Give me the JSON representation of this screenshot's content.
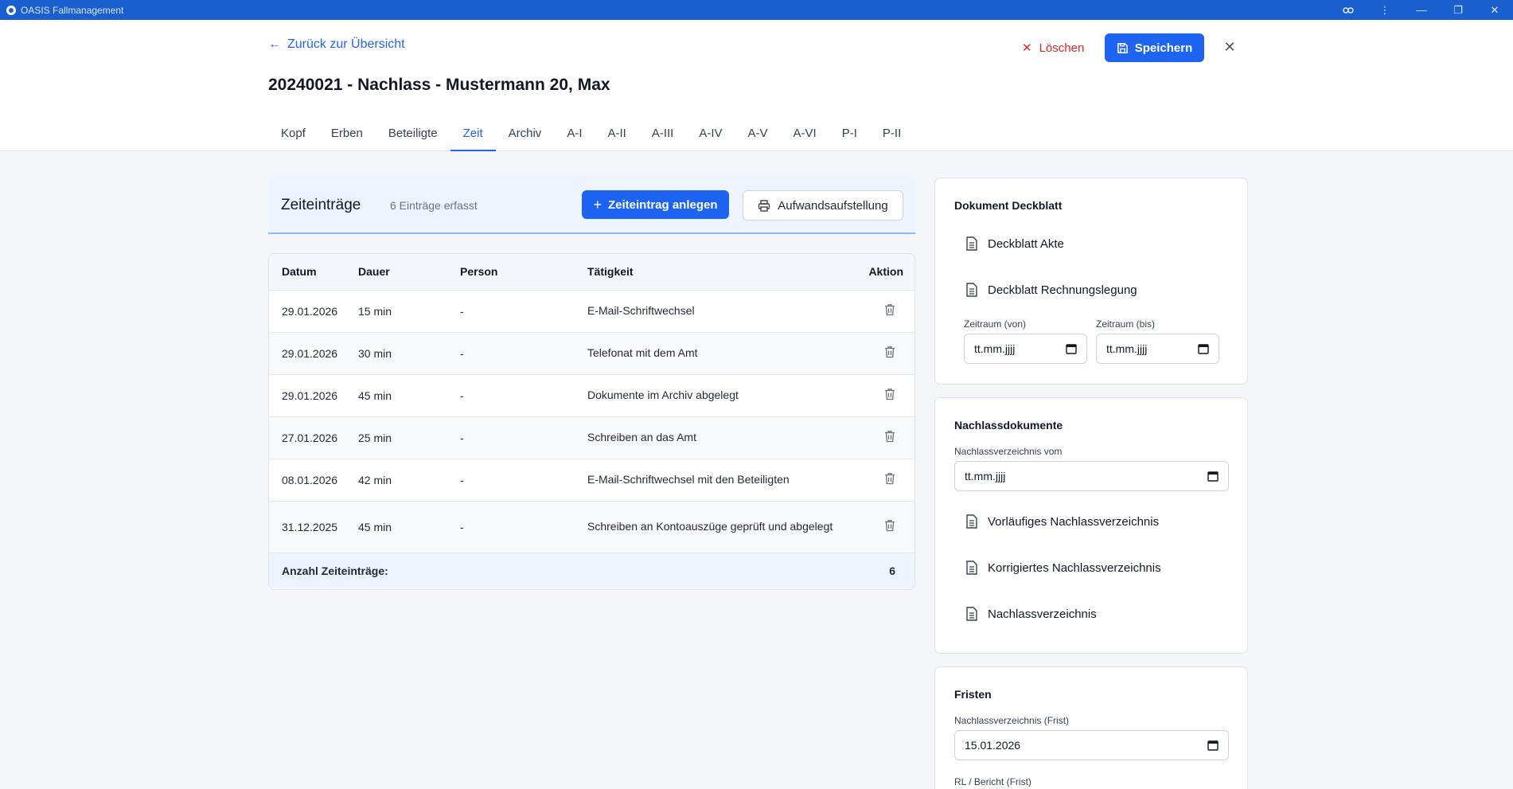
{
  "window": {
    "title": "OASIS Fallmanagement",
    "controls": [
      "key-icon",
      "more-icon",
      "minimize-icon",
      "restore-icon",
      "close-icon"
    ]
  },
  "header": {
    "back_label": "Zurück zur Übersicht",
    "page_title": "20240021 - Nachlass - Mustermann 20, Max",
    "delete_label": "Löschen",
    "save_label": "Speichern",
    "tabs": [
      {
        "label": "Kopf",
        "active": false
      },
      {
        "label": "Erben",
        "active": false
      },
      {
        "label": "Beteiligte",
        "active": false
      },
      {
        "label": "Zeit",
        "active": true
      },
      {
        "label": "Archiv",
        "active": false
      },
      {
        "label": "A-I",
        "active": false
      },
      {
        "label": "A-II",
        "active": false
      },
      {
        "label": "A-III",
        "active": false
      },
      {
        "label": "A-IV",
        "active": false
      },
      {
        "label": "A-V",
        "active": false
      },
      {
        "label": "A-VI",
        "active": false
      },
      {
        "label": "P-I",
        "active": false
      },
      {
        "label": "P-II",
        "active": false
      }
    ]
  },
  "time": {
    "title": "Zeiteinträge",
    "count_text": "6 Einträge erfasst",
    "add_label": "Zeiteintrag anlegen",
    "print_label": "Aufwandsaufstellung",
    "columns": {
      "date": "Datum",
      "duration": "Dauer",
      "person": "Person",
      "activity": "Tätigkeit",
      "action": "Aktion"
    },
    "rows": [
      {
        "date": "29.01.2026",
        "duration": "15 min",
        "person": "-",
        "activity": "E-Mail-Schriftwechsel"
      },
      {
        "date": "29.01.2026",
        "duration": "30 min",
        "person": "-",
        "activity": "Telefonat mit dem Amt"
      },
      {
        "date": "29.01.2026",
        "duration": "45 min",
        "person": "-",
        "activity": "Dokumente im Archiv abgelegt"
      },
      {
        "date": "27.01.2026",
        "duration": "25 min",
        "person": "-",
        "activity": "Schreiben an das Amt"
      },
      {
        "date": "08.01.2026",
        "duration": "42 min",
        "person": "-",
        "activity": "E-Mail-Schriftwechsel mit den Beteiligten"
      },
      {
        "date": "31.12.2025",
        "duration": "45 min",
        "person": "-",
        "activity": "Schreiben an Kontoauszüge geprüft und abgelegt"
      }
    ],
    "footer_label": "Anzahl Zeiteinträge:",
    "footer_value": "6"
  },
  "deckblatt": {
    "title": "Dokument Deckblatt",
    "items": [
      "Deckblatt Akte",
      "Deckblatt Rechnungslegung"
    ],
    "from_label": "Zeitraum (von)",
    "to_label": "Zeitraum (bis)",
    "from_value": "tt.mm.jjjj",
    "to_value": "tt.mm.jjjj"
  },
  "nachlass": {
    "title": "Nachlassdokumente",
    "date_label": "Nachlassverzeichnis vom",
    "date_value": "tt.mm.jjjj",
    "items": [
      "Vorläufiges Nachlassverzeichnis",
      "Korrigiertes Nachlassverzeichnis",
      "Nachlassverzeichnis"
    ]
  },
  "fristen": {
    "title": "Fristen",
    "frist1_label": "Nachlassverzeichnis (Frist)",
    "frist1_value": "15.01.2026",
    "frist2_label": "RL / Bericht (Frist)"
  },
  "colors": {
    "accent": "#1d64f2",
    "titlebar": "#1a5fd0",
    "danger": "#dc2626"
  }
}
